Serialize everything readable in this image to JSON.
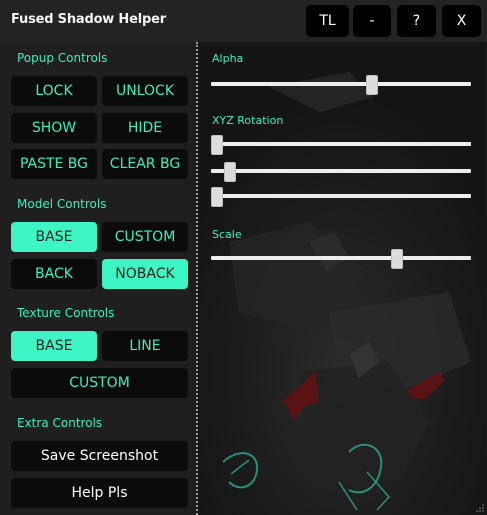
{
  "window": {
    "title": "Fused Shadow Helper",
    "buttons": {
      "tl": "TL",
      "minimize": "-",
      "help": "?",
      "close": "X"
    }
  },
  "popup_controls": {
    "heading": "Popup Controls",
    "lock": "LOCK",
    "unlock": "UNLOCK",
    "show": "SHOW",
    "hide": "HIDE",
    "paste_bg": "PASTE BG",
    "clear_bg": "CLEAR BG"
  },
  "model_controls": {
    "heading": "Model Controls",
    "base": "BASE",
    "custom": "CUSTOM",
    "back": "BACK",
    "noback": "NOBACK",
    "active": [
      "BASE",
      "NOBACK"
    ]
  },
  "texture_controls": {
    "heading": "Texture Controls",
    "base": "BASE",
    "line": "LINE",
    "custom": "CUSTOM",
    "active": [
      "BASE"
    ]
  },
  "extra_controls": {
    "heading": "Extra Controls",
    "save_screenshot": "Save Screenshot",
    "help": "Help Pls"
  },
  "sliders": {
    "alpha": {
      "label": "Alpha",
      "value": 0.62
    },
    "xyz_rotation": {
      "label": "XYZ Rotation",
      "x": 0.0,
      "y": 0.05,
      "z": 0.0
    },
    "scale": {
      "label": "Scale",
      "value": 0.72
    }
  },
  "colors": {
    "accent": "#36f0c0",
    "active_button": "#3ef5c4",
    "button_bg": "#0b0b0b",
    "window_bg": "#181818"
  }
}
